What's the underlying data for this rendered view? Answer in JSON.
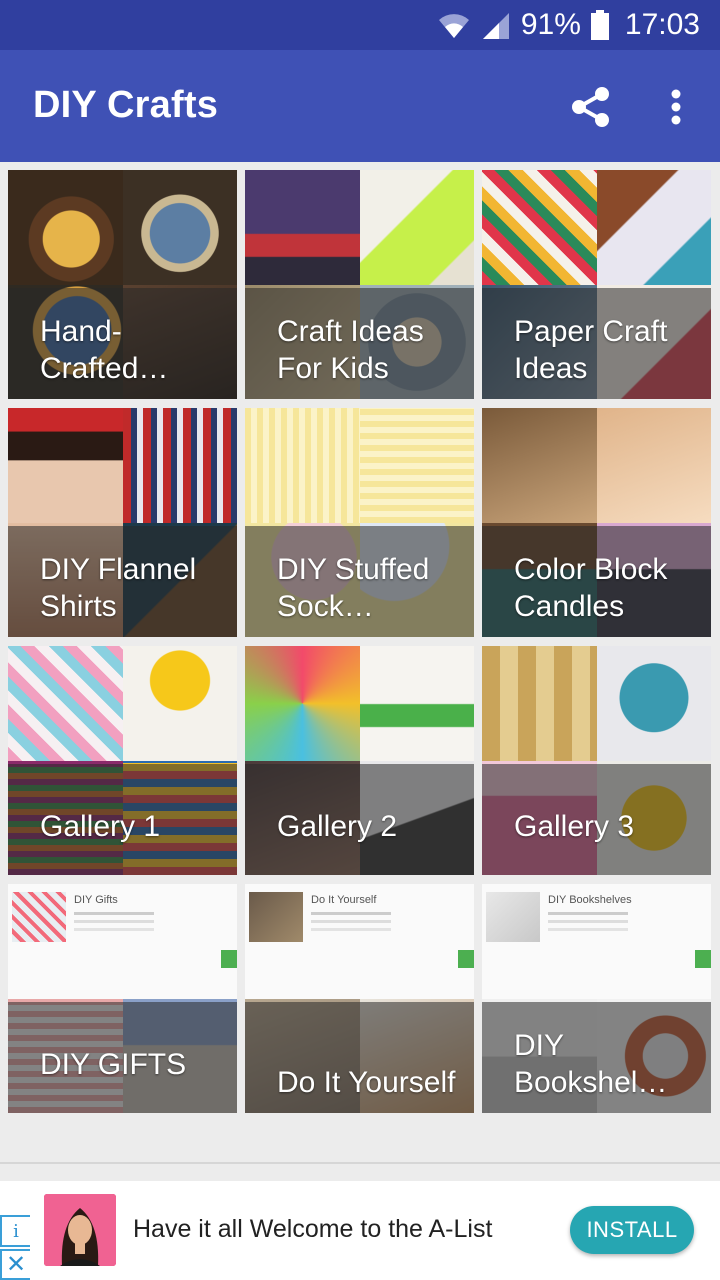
{
  "status_bar": {
    "battery_text": "91%",
    "time": "17:03",
    "icons": [
      "wifi-icon",
      "signal-icon",
      "battery-icon"
    ]
  },
  "app_bar": {
    "title": "DIY Crafts",
    "actions": [
      "share-icon",
      "more-vert-icon"
    ],
    "background": "#3f51b5",
    "status_background": "#303f9f"
  },
  "grid": {
    "tiles": [
      {
        "label": "Hand-\nCrafted…"
      },
      {
        "label": "Craft Ideas For Kids"
      },
      {
        "label": "Paper Craft Ideas"
      },
      {
        "label": "DIY Flannel Shirts"
      },
      {
        "label": "DIY Stuffed Sock…"
      },
      {
        "label": "Color Block Candles"
      },
      {
        "label": "Gallery 1"
      },
      {
        "label": "Gallery 2"
      },
      {
        "label": "Gallery 3"
      },
      {
        "label": "DIY GIFTS"
      },
      {
        "label": "Do It Yourself"
      },
      {
        "label": "DIY Bookshel…"
      }
    ],
    "screenshot_titles": [
      "DIY Gifts",
      "Do It Yourself",
      "DIY Bookshelves"
    ]
  },
  "ad": {
    "text": "Have it all Welcome to the A-List",
    "install_label": "INSTALL",
    "info_glyph": "i",
    "close_glyph": "✕",
    "accent": "#26a6b2"
  }
}
